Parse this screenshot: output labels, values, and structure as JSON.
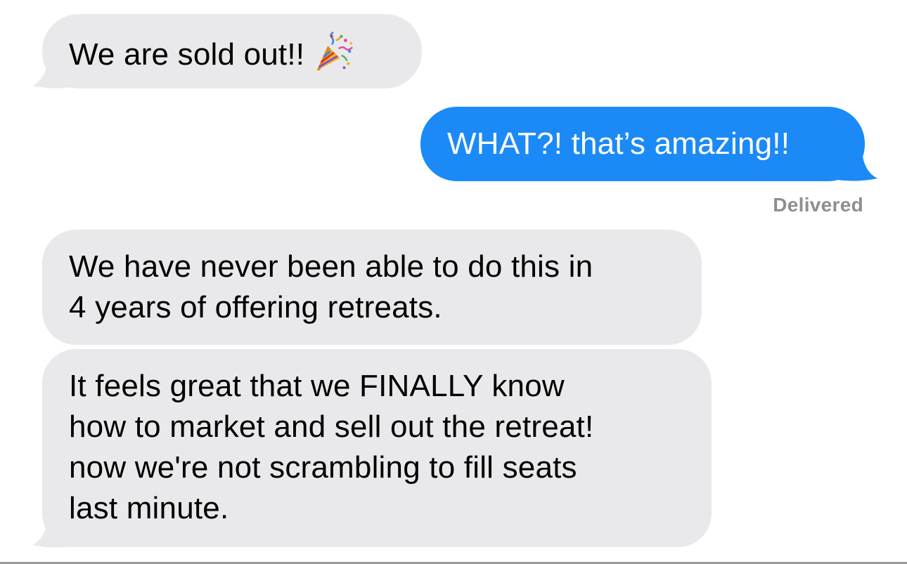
{
  "messages": [
    {
      "direction": "incoming",
      "lines": [
        "We are sold out!!"
      ],
      "emoji": "party-popper-icon"
    },
    {
      "direction": "outgoing",
      "lines": [
        "WHAT?! that’s amazing!!"
      ]
    },
    {
      "direction": "incoming",
      "lines": [
        "We have never been able to do this in",
        "4 years of offering retreats."
      ]
    },
    {
      "direction": "incoming",
      "lines": [
        "It feels great that we FINALLY know",
        "how to market and sell out the retreat!",
        "now we're not scrambling to fill seats",
        "last minute."
      ]
    }
  ],
  "status": "Delivered",
  "colors": {
    "incoming_bubble": "#e9e9eb",
    "outgoing_bubble": "#1b8af6",
    "status_text": "#8e8e93"
  }
}
